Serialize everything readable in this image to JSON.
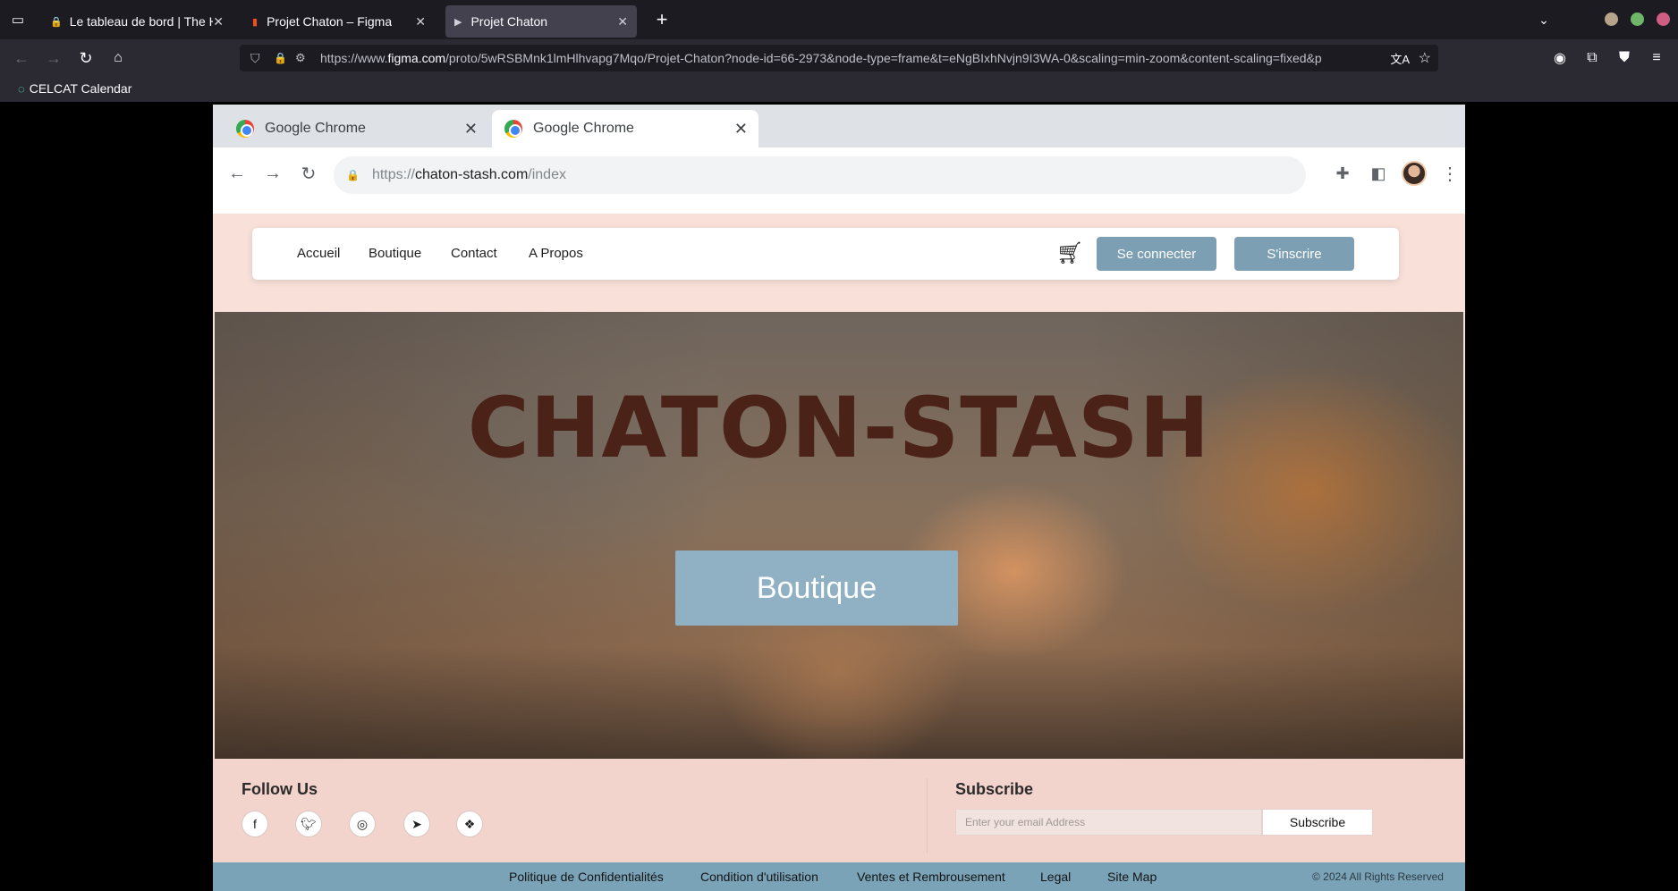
{
  "firefox": {
    "tabs": [
      {
        "label": "Le tableau de bord | The H"
      },
      {
        "label": "Projet Chaton – Figma"
      },
      {
        "label": "Projet Chaton"
      }
    ],
    "url_prefix": "https://www.",
    "url_domain": "figma.com",
    "url_rest": "/proto/5wRSBMnk1lmHlhvapg7Mqo/Projet-Chaton?node-id=66-2973&node-type=frame&t=eNgBIxhNvjn9I3WA-0&scaling=min-zoom&content-scaling=fixed&p",
    "bookmark": "CELCAT Calendar"
  },
  "chrome": {
    "tabs": [
      {
        "label": "Google Chrome"
      },
      {
        "label": "Google Chrome"
      }
    ],
    "url_scheme": "https://",
    "url_domain": "chaton-stash.com",
    "url_path": "/index"
  },
  "site": {
    "nav": [
      "Accueil",
      "Boutique",
      "Contact",
      "A Propos"
    ],
    "login": "Se connecter",
    "signup": "S'inscrire",
    "hero_title": "CHATON-STASH",
    "hero_button": "Boutique",
    "follow_heading": "Follow Us",
    "subscribe_heading": "Subscribe",
    "email_placeholder": "Enter your email Address",
    "subscribe_button": "Subscribe",
    "social_icons": [
      "facebook-icon",
      "twitter-icon",
      "instagram-icon",
      "telegram-icon",
      "figma-icon"
    ],
    "legal_links": [
      "Politique de Confidentialités",
      "Condition d'utilisation",
      "Ventes et Rembrousement",
      "Legal",
      "Site Map"
    ],
    "copyright": "© 2024 All Rights Reserved"
  },
  "colors": {
    "accent_blue": "#7d9fb3",
    "hero_button": "#90b0c4",
    "hero_title": "#4a2217",
    "footer_pink": "#f3d4cd",
    "legal_bar": "#7aa3b8"
  }
}
